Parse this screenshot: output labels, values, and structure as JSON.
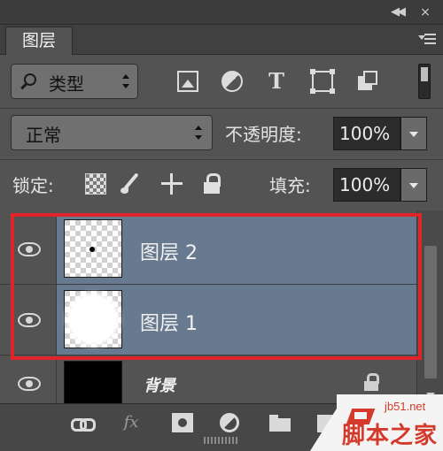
{
  "panel": {
    "tab_label": "图层"
  },
  "filter": {
    "kind_label": "类型",
    "icons": [
      "image-filter-icon",
      "adjustment-filter-icon",
      "type-filter-icon",
      "shape-filter-icon",
      "smart-object-filter-icon"
    ]
  },
  "blend": {
    "mode": "正常",
    "opacity_label": "不透明度:",
    "opacity_value": "100%"
  },
  "lock": {
    "label": "锁定:",
    "fill_label": "填充:",
    "fill_value": "100%"
  },
  "layers": [
    {
      "name": "图层 2",
      "selected": true,
      "thumb": "small-dot"
    },
    {
      "name": "图层 1",
      "selected": true,
      "thumb": "white-circle"
    },
    {
      "name": "背景",
      "selected": false,
      "thumb": "black",
      "locked": true
    }
  ],
  "highlight_color": "#e0252a",
  "selection_color": "#687a90",
  "watermark": {
    "url": "jb51.net",
    "name": "脚本之家"
  }
}
